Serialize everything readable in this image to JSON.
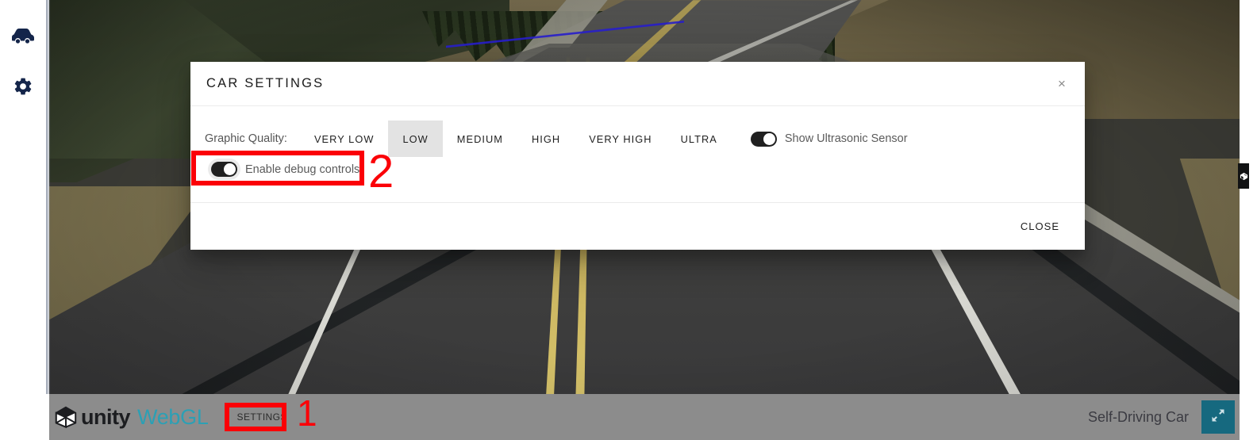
{
  "app": {
    "title": "Self-Driving Car",
    "product_logo_unity": "unity",
    "product_logo_webgl": "WebGL"
  },
  "sidebar": {
    "items": [
      {
        "name": "car-icon",
        "label": "Car"
      },
      {
        "name": "gear-icon",
        "label": "Settings"
      }
    ]
  },
  "dialog": {
    "title": "CAR SETTINGS",
    "close_x": "×",
    "quality_label": "Graphic Quality:",
    "quality_options": [
      {
        "label": "VERY LOW",
        "selected": false
      },
      {
        "label": "LOW",
        "selected": true
      },
      {
        "label": "MEDIUM",
        "selected": false
      },
      {
        "label": "HIGH",
        "selected": false
      },
      {
        "label": "VERY HIGH",
        "selected": false
      },
      {
        "label": "ULTRA",
        "selected": false
      }
    ],
    "ultrasonic_toggle": {
      "label": "Show Ultrasonic Sensor",
      "on": true
    },
    "debug_toggle": {
      "label": "Enable debug controls",
      "on": true
    },
    "close_button": "CLOSE"
  },
  "bottom_bar": {
    "settings_button": "SETTINGS",
    "app_title": "Self-Driving Car",
    "fullscreen_icon": "fullscreen-icon"
  },
  "annotations": [
    {
      "number": "1",
      "target": "settings-button",
      "color": "#fb0007"
    },
    {
      "number": "2",
      "target": "enable-debug-controls-toggle",
      "color": "#fb0007"
    }
  ],
  "colors": {
    "annotation_red": "#fb0007",
    "accent_teal": "#2ba0b5",
    "fullscreen_button": "#16697f",
    "bottom_bar": "#8c8c8c",
    "selected_quality": "#e3e3e3",
    "sidebar_icon": "#14254a"
  }
}
